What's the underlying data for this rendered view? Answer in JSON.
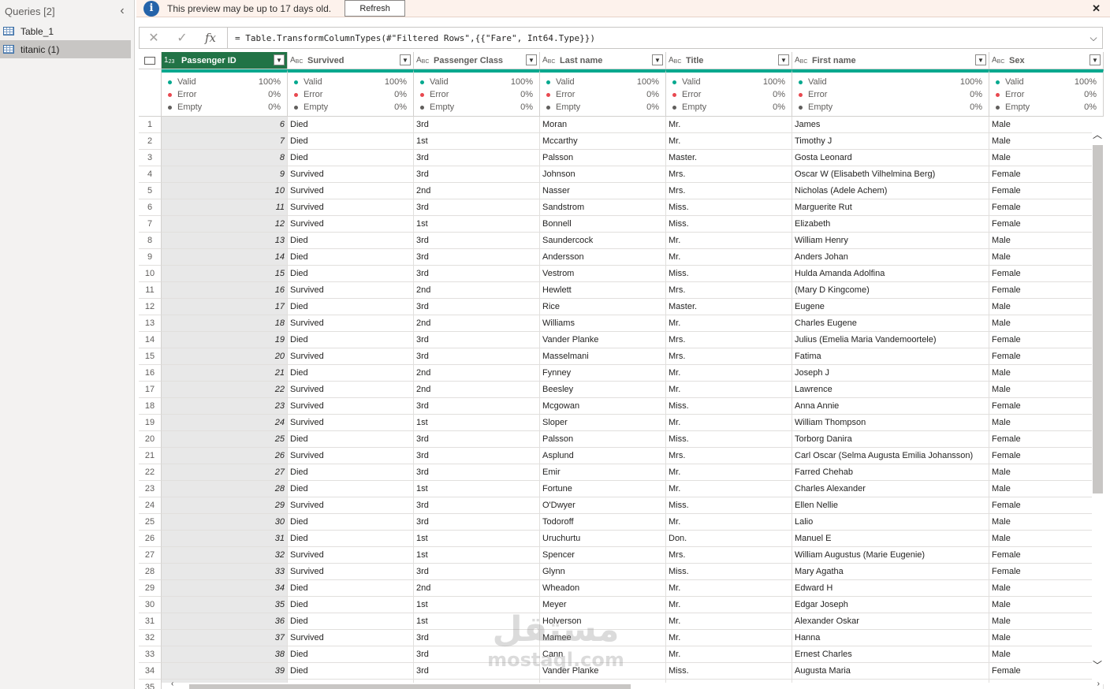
{
  "queries": {
    "title": "Queries [2]",
    "items": [
      {
        "label": "Table_1",
        "selected": false
      },
      {
        "label": "titanic (1)",
        "selected": true
      }
    ]
  },
  "notification": {
    "text": "This preview may be up to 17 days old.",
    "refresh_label": "Refresh",
    "info_glyph": "i",
    "close_glyph": "✕"
  },
  "formula_bar": {
    "cancel_glyph": "✕",
    "commit_glyph": "✓",
    "fx_label": "fx",
    "formula": "= Table.TransformColumnTypes(#\"Filtered Rows\",{{\"Fare\", Int64.Type}})",
    "expand_glyph": "⌵"
  },
  "columns": [
    {
      "name": "Passenger ID",
      "type": "int",
      "width": 160,
      "active": true
    },
    {
      "name": "Survived",
      "type": "text",
      "width": 160,
      "active": false
    },
    {
      "name": "Passenger Class",
      "type": "text",
      "width": 160,
      "active": false
    },
    {
      "name": "Last name",
      "type": "text",
      "width": 160,
      "active": false
    },
    {
      "name": "Title",
      "type": "text",
      "width": 160,
      "active": false
    },
    {
      "name": "First name",
      "type": "text",
      "width": 250,
      "active": false
    },
    {
      "name": "Sex",
      "type": "text",
      "width": 145,
      "active": false
    }
  ],
  "quality": {
    "labels": [
      "Valid",
      "Error",
      "Empty"
    ],
    "values": [
      "100%",
      "0%",
      "0%"
    ],
    "colors": [
      "#00a88e",
      "#e8484f",
      "#605e5c"
    ]
  },
  "rows": [
    [
      "1",
      "6",
      "Died",
      "3rd",
      "Moran",
      "Mr.",
      "James",
      "Male"
    ],
    [
      "2",
      "7",
      "Died",
      "1st",
      "Mccarthy",
      "Mr.",
      "Timothy J",
      "Male"
    ],
    [
      "3",
      "8",
      "Died",
      "3rd",
      "Palsson",
      "Master.",
      "Gosta Leonard",
      "Male"
    ],
    [
      "4",
      "9",
      "Survived",
      "3rd",
      "Johnson",
      "Mrs.",
      "Oscar W (Elisabeth Vilhelmina Berg)",
      "Female"
    ],
    [
      "5",
      "10",
      "Survived",
      "2nd",
      "Nasser",
      "Mrs.",
      "Nicholas (Adele Achem)",
      "Female"
    ],
    [
      "6",
      "11",
      "Survived",
      "3rd",
      "Sandstrom",
      "Miss.",
      "Marguerite Rut",
      "Female"
    ],
    [
      "7",
      "12",
      "Survived",
      "1st",
      "Bonnell",
      "Miss.",
      "Elizabeth",
      "Female"
    ],
    [
      "8",
      "13",
      "Died",
      "3rd",
      "Saundercock",
      "Mr.",
      "William Henry",
      "Male"
    ],
    [
      "9",
      "14",
      "Died",
      "3rd",
      "Andersson",
      "Mr.",
      "Anders Johan",
      "Male"
    ],
    [
      "10",
      "15",
      "Died",
      "3rd",
      "Vestrom",
      "Miss.",
      "Hulda Amanda Adolfina",
      "Female"
    ],
    [
      "11",
      "16",
      "Survived",
      "2nd",
      "Hewlett",
      "Mrs.",
      "(Mary D Kingcome)",
      "Female"
    ],
    [
      "12",
      "17",
      "Died",
      "3rd",
      "Rice",
      "Master.",
      "Eugene",
      "Male"
    ],
    [
      "13",
      "18",
      "Survived",
      "2nd",
      "Williams",
      "Mr.",
      "Charles Eugene",
      "Male"
    ],
    [
      "14",
      "19",
      "Died",
      "3rd",
      "Vander Planke",
      "Mrs.",
      "Julius (Emelia Maria Vandemoortele)",
      "Female"
    ],
    [
      "15",
      "20",
      "Survived",
      "3rd",
      "Masselmani",
      "Mrs.",
      "Fatima",
      "Female"
    ],
    [
      "16",
      "21",
      "Died",
      "2nd",
      "Fynney",
      "Mr.",
      "Joseph J",
      "Male"
    ],
    [
      "17",
      "22",
      "Survived",
      "2nd",
      "Beesley",
      "Mr.",
      "Lawrence",
      "Male"
    ],
    [
      "18",
      "23",
      "Survived",
      "3rd",
      "Mcgowan",
      "Miss.",
      "Anna Annie",
      "Female"
    ],
    [
      "19",
      "24",
      "Survived",
      "1st",
      "Sloper",
      "Mr.",
      "William Thompson",
      "Male"
    ],
    [
      "20",
      "25",
      "Died",
      "3rd",
      "Palsson",
      "Miss.",
      "Torborg Danira",
      "Female"
    ],
    [
      "21",
      "26",
      "Survived",
      "3rd",
      "Asplund",
      "Mrs.",
      "Carl Oscar (Selma Augusta Emilia Johansson)",
      "Female"
    ],
    [
      "22",
      "27",
      "Died",
      "3rd",
      "Emir",
      "Mr.",
      "Farred Chehab",
      "Male"
    ],
    [
      "23",
      "28",
      "Died",
      "1st",
      "Fortune",
      "Mr.",
      "Charles Alexander",
      "Male"
    ],
    [
      "24",
      "29",
      "Survived",
      "3rd",
      "O'Dwyer",
      "Miss.",
      "Ellen Nellie",
      "Female"
    ],
    [
      "25",
      "30",
      "Died",
      "3rd",
      "Todoroff",
      "Mr.",
      "Lalio",
      "Male"
    ],
    [
      "26",
      "31",
      "Died",
      "1st",
      "Uruchurtu",
      "Don.",
      "Manuel E",
      "Male"
    ],
    [
      "27",
      "32",
      "Survived",
      "1st",
      "Spencer",
      "Mrs.",
      "William Augustus (Marie Eugenie)",
      "Female"
    ],
    [
      "28",
      "33",
      "Survived",
      "3rd",
      "Glynn",
      "Miss.",
      "Mary Agatha",
      "Female"
    ],
    [
      "29",
      "34",
      "Died",
      "2nd",
      "Wheadon",
      "Mr.",
      "Edward H",
      "Male"
    ],
    [
      "30",
      "35",
      "Died",
      "1st",
      "Meyer",
      "Mr.",
      "Edgar Joseph",
      "Male"
    ],
    [
      "31",
      "36",
      "Died",
      "1st",
      "Holverson",
      "Mr.",
      "Alexander Oskar",
      "Male"
    ],
    [
      "32",
      "37",
      "Survived",
      "3rd",
      "Mamee",
      "Mr.",
      "Hanna",
      "Male"
    ],
    [
      "33",
      "38",
      "Died",
      "3rd",
      "Cann",
      "Mr.",
      "Ernest Charles",
      "Male"
    ],
    [
      "34",
      "39",
      "Died",
      "3rd",
      "Vander Planke",
      "Miss.",
      "Augusta Maria",
      "Female"
    ],
    [
      "35",
      "",
      "",
      "",
      "",
      "",
      "",
      ""
    ]
  ],
  "watermark": {
    "arabic": "مستقل",
    "latin": "mostaql.com"
  }
}
